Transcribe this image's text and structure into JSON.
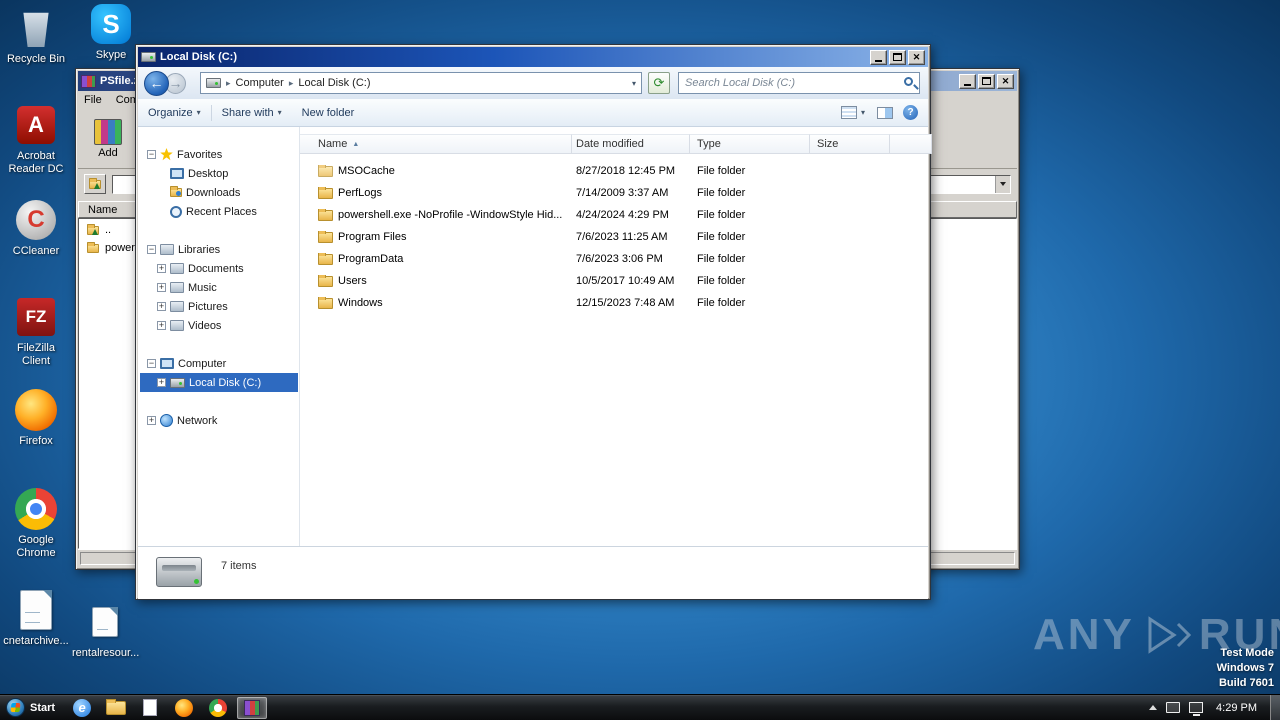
{
  "colors": {
    "selection": "#2e6ac0",
    "titlebar_start": "#0a246a",
    "titlebar_end": "#8cb4e8",
    "desktop_center": "#4fa9e2",
    "desktop_edge": "#0a355f"
  },
  "glyphs": {
    "caret": "▾",
    "crumb_sep": "▸",
    "sort": "▲",
    "close": "✕",
    "plus": "+",
    "minus": "−",
    "refresh": "⟳",
    "help": "?",
    "back": "←",
    "fwd": "→",
    "ie": "e"
  },
  "desktop": {
    "icons": [
      {
        "label": "Recycle Bin"
      },
      {
        "label": "Skype",
        "glyph": "S"
      },
      {
        "label": "Acrobat Reader DC",
        "glyph": "A"
      },
      {
        "label": "CCleaner",
        "glyph": "C"
      },
      {
        "label": "FileZilla Client",
        "glyph": "FZ"
      },
      {
        "label": "Firefox"
      },
      {
        "label": "Google Chrome"
      },
      {
        "label": "cnetarchive..."
      },
      {
        "label": "rentalresour..."
      }
    ]
  },
  "winrar": {
    "title": "PSfile.zi...",
    "menu": [
      "File",
      "Comm"
    ],
    "add_label": "Add",
    "name_col": "Name",
    "rows": [
      "..",
      "powersh"
    ]
  },
  "explorer": {
    "title": "Local Disk (C:)",
    "breadcrumb": [
      "Computer",
      "Local Disk (C:)"
    ],
    "search_placeholder": "Search Local Disk (C:)",
    "toolbar": {
      "organize": "Organize",
      "share": "Share with",
      "new_folder": "New folder"
    },
    "columns": [
      "Name",
      "Date modified",
      "Type",
      "Size"
    ],
    "sidebar": [
      {
        "label": "Favorites",
        "exp": "−"
      },
      {
        "label": "Desktop",
        "exp": ""
      },
      {
        "label": "Downloads",
        "exp": ""
      },
      {
        "label": "Recent Places",
        "exp": ""
      },
      {
        "label": "Libraries",
        "exp": "−"
      },
      {
        "label": "Documents",
        "exp": "+"
      },
      {
        "label": "Music",
        "exp": "+"
      },
      {
        "label": "Pictures",
        "exp": "+"
      },
      {
        "label": "Videos",
        "exp": "+"
      },
      {
        "label": "Computer",
        "exp": "−"
      },
      {
        "label": "Local Disk (C:)",
        "exp": "+"
      },
      {
        "label": "Network",
        "exp": "+"
      }
    ],
    "files": [
      {
        "name": "MSOCache",
        "date": "8/27/2018 12:45 PM",
        "type": "File folder",
        "size": ""
      },
      {
        "name": "PerfLogs",
        "date": "7/14/2009 3:37 AM",
        "type": "File folder",
        "size": ""
      },
      {
        "name": "powershell.exe  -NoProfile -WindowStyle Hid...",
        "date": "4/24/2024 4:29 PM",
        "type": "File folder",
        "size": ""
      },
      {
        "name": "Program Files",
        "date": "7/6/2023 11:25 AM",
        "type": "File folder",
        "size": ""
      },
      {
        "name": "ProgramData",
        "date": "7/6/2023 3:06 PM",
        "type": "File folder",
        "size": ""
      },
      {
        "name": "Users",
        "date": "10/5/2017 10:49 AM",
        "type": "File folder",
        "size": ""
      },
      {
        "name": "Windows",
        "date": "12/15/2023 7:48 AM",
        "type": "File folder",
        "size": ""
      }
    ],
    "status": "7 items"
  },
  "watermark": {
    "brand_left": "ANY",
    "brand_right": "RUN",
    "lines": [
      "Test Mode",
      "Windows 7",
      "Build 7601"
    ]
  },
  "taskbar": {
    "start": "Start",
    "clock": "4:29 PM"
  }
}
